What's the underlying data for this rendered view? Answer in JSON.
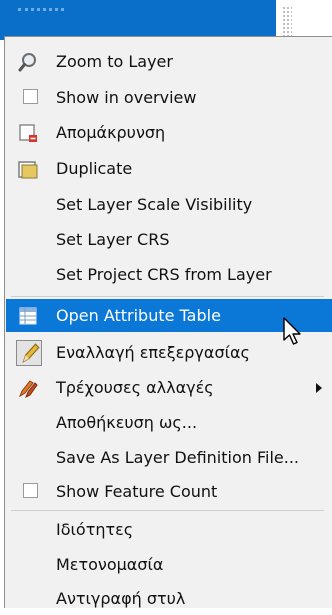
{
  "menu": {
    "items": [
      {
        "label": "Zoom to Layer",
        "icon": "magnifier-icon"
      },
      {
        "label": "Show in overview",
        "icon": "checkbox"
      },
      {
        "label": "Απομάκρυνση",
        "icon": "remove-layer-icon"
      },
      {
        "label": "Duplicate",
        "icon": "duplicate-layer-icon"
      },
      {
        "label": "Set Layer Scale Visibility"
      },
      {
        "label": "Set Layer CRS"
      },
      {
        "label": "Set Project CRS from Layer"
      },
      {
        "label": "Open Attribute Table",
        "icon": "attribute-table-icon",
        "highlighted": true
      },
      {
        "label": "Εναλλαγή επεξεργασίας",
        "icon": "pencil-icon"
      },
      {
        "label": "Τρέχουσες αλλαγές",
        "icon": "edits-icon",
        "submenu": true
      },
      {
        "label": "Αποθήκευση ως..."
      },
      {
        "label": "Save As Layer Definition File..."
      },
      {
        "label": "Show Feature Count",
        "icon": "checkbox"
      },
      {
        "label": "Ιδιότητες"
      },
      {
        "label": "Μετονομασία"
      },
      {
        "label": "Αντιγραφή στυλ"
      }
    ]
  },
  "colors": {
    "highlight": "#0b78d7",
    "menu_bg": "#f1f1f1",
    "layer_selection": "#0a6fc9"
  }
}
